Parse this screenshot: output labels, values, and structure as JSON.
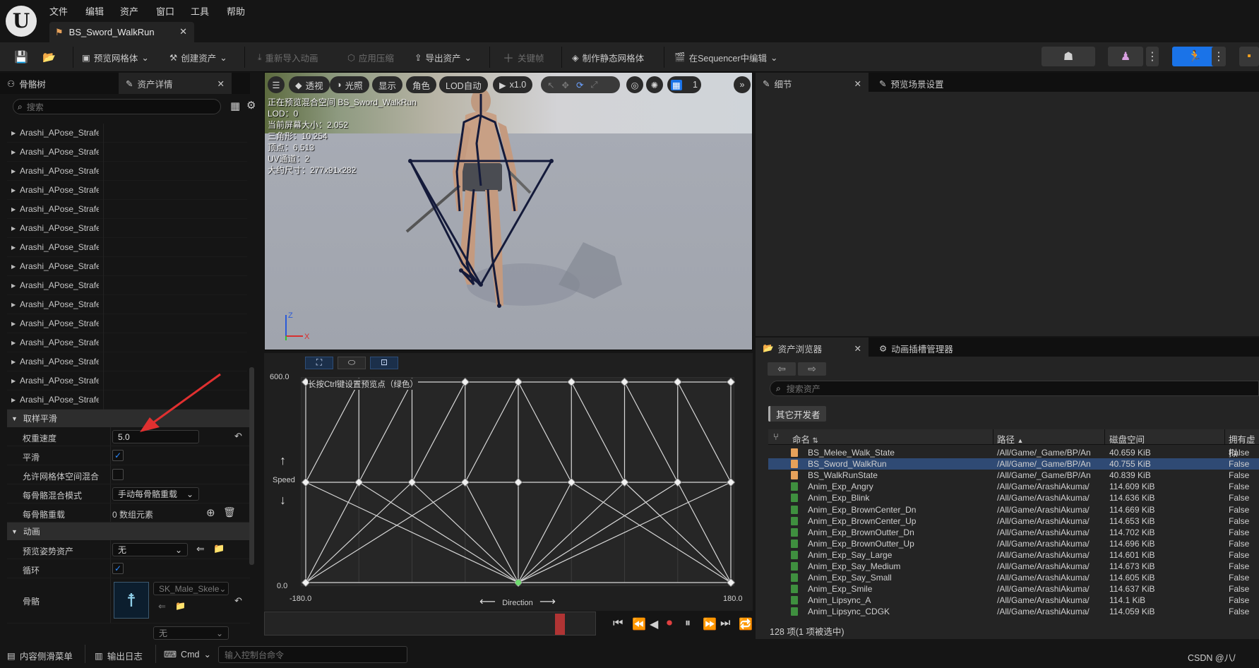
{
  "menu": {
    "items": [
      "文件",
      "编辑",
      "资产",
      "窗口",
      "工具",
      "帮助"
    ]
  },
  "document_tab": {
    "title": "BS_Sword_WalkRun"
  },
  "toolbar": {
    "preview_mesh": "预览网格体",
    "create_asset": "创建资产",
    "reimport": "重新导入动画",
    "apply_compression": "应用压缩",
    "export_asset": "导出资产",
    "key": "关键帧",
    "make_static_mesh": "制作静态网格体",
    "edit_in_sequencer": "在Sequencer中编辑"
  },
  "left_panel": {
    "tabs": [
      "骨骼树",
      "资产详情"
    ],
    "search_placeholder": "搜索",
    "tree_rows": [
      "Arashi_APose_Strafe_\\",
      "Arashi_APose_Strafe_\\",
      "Arashi_APose_Strafe_\\",
      "Arashi_APose_Strafe_\\",
      "Arashi_APose_Strafe_\\",
      "Arashi_APose_Strafe_\\",
      "Arashi_APose_Strafe_I",
      "Arashi_APose_Strafe_I",
      "Arashi_APose_Strafe_I",
      "Arashi_APose_Strafe_I",
      "Arashi_APose_Strafe_I",
      "Arashi_APose_Strafe_I",
      "Arashi_APose_Strafe_I",
      "Arashi_APose_Strafe_I",
      "Arashi_APose_Strafe_I"
    ],
    "section_sampling": "取样平滑",
    "weight_speed_label": "权重速度",
    "weight_speed_value": "5.0",
    "smooth_label": "平滑",
    "smooth_checked": true,
    "mesh_space_label": "允许网格体空间混合",
    "mesh_space_checked": false,
    "per_bone_mode_label": "每骨骼混合模式",
    "per_bone_mode_value": "手动每骨骼重载",
    "per_bone_override_label": "每骨骼重载",
    "per_bone_override_value": "0 数组元素",
    "section_animation": "动画",
    "preview_pose_label": "预览姿势资产",
    "preview_pose_value": "无",
    "loop_label": "循环",
    "loop_checked": true,
    "skeleton_label": "骨骼",
    "skeleton_value": "SK_Male_Skele",
    "next_combo_value": "无"
  },
  "viewport": {
    "buttons": {
      "perspective": "透视",
      "lit": "光照",
      "show": "显示",
      "character": "角色",
      "lod": "LOD自动",
      "speed": "x1.0",
      "grid_num": "1"
    },
    "info_lines": [
      "正在预览混合空间 BS_Sword_WalkRun",
      "LOD：0",
      "当前屏幕大小：2.052",
      "三角形：10,254",
      "顶点：6,513",
      "UV通道：2",
      "大约尺寸：277x91x282"
    ],
    "axis_z": "Z",
    "axis_x": "X"
  },
  "blend_space": {
    "hint": "长按Ctrl键设置预览点（绿色）",
    "y_max": "600.0",
    "y_min": "0.0",
    "x_min": "-180.0",
    "x_max": "180.0",
    "y_name": "Speed",
    "x_name": "Direction"
  },
  "chart_data": {
    "type": "scatter",
    "title": "",
    "xlabel": "Direction",
    "ylabel": "Speed",
    "xlim": [
      -180,
      180
    ],
    "ylim": [
      0,
      600
    ],
    "x_ticks": [
      "-180.0",
      "180.0"
    ],
    "y_ticks": [
      "0.0",
      "600.0"
    ],
    "grid": true,
    "series": [
      {
        "points": [
          [
            -180,
            0
          ],
          [
            0,
            0
          ],
          [
            180,
            0
          ],
          [
            -180,
            300
          ],
          [
            -135,
            300
          ],
          [
            -90,
            300
          ],
          [
            -45,
            300
          ],
          [
            0,
            300
          ],
          [
            45,
            300
          ],
          [
            90,
            300
          ],
          [
            135,
            300
          ],
          [
            180,
            300
          ],
          [
            -180,
            600
          ],
          [
            -135,
            600
          ],
          [
            -90,
            600
          ],
          [
            -45,
            600
          ],
          [
            0,
            600
          ],
          [
            45,
            600
          ],
          [
            90,
            600
          ],
          [
            135,
            600
          ],
          [
            180,
            600
          ]
        ]
      }
    ]
  },
  "details": {
    "tabs": [
      "细节",
      "预览场景设置"
    ]
  },
  "content_browser": {
    "tabs": [
      "资产浏览器",
      "动画插槽管理器"
    ],
    "search_placeholder": "搜索资产",
    "filter": "其它开发者",
    "columns": [
      "命名",
      "路径",
      "磁盘空间",
      "拥有虚拟"
    ],
    "rows": [
      {
        "name": "BS_Melee_Walk_State",
        "path": "/All/Game/_Game/BP/An",
        "size": "40.659 KiB",
        "flag": "False",
        "kind": "blend"
      },
      {
        "name": "BS_Sword_WalkRun",
        "path": "/All/Game/_Game/BP/An",
        "size": "40.755 KiB",
        "flag": "False",
        "kind": "blend",
        "selected": true
      },
      {
        "name": "BS_WalkRunState",
        "path": "/All/Game/_Game/BP/An",
        "size": "40.839 KiB",
        "flag": "False",
        "kind": "blend"
      },
      {
        "name": "Anim_Exp_Angry",
        "path": "/All/Game/ArashiAkuma/",
        "size": "114.609 KiB",
        "flag": "False",
        "kind": "anim"
      },
      {
        "name": "Anim_Exp_Blink",
        "path": "/All/Game/ArashiAkuma/",
        "size": "114.636 KiB",
        "flag": "False",
        "kind": "anim"
      },
      {
        "name": "Anim_Exp_BrownCenter_Dn",
        "path": "/All/Game/ArashiAkuma/",
        "size": "114.669 KiB",
        "flag": "False",
        "kind": "anim"
      },
      {
        "name": "Anim_Exp_BrownCenter_Up",
        "path": "/All/Game/ArashiAkuma/",
        "size": "114.653 KiB",
        "flag": "False",
        "kind": "anim"
      },
      {
        "name": "Anim_Exp_BrownOutter_Dn",
        "path": "/All/Game/ArashiAkuma/",
        "size": "114.702 KiB",
        "flag": "False",
        "kind": "anim"
      },
      {
        "name": "Anim_Exp_BrownOutter_Up",
        "path": "/All/Game/ArashiAkuma/",
        "size": "114.696 KiB",
        "flag": "False",
        "kind": "anim"
      },
      {
        "name": "Anim_Exp_Say_Large",
        "path": "/All/Game/ArashiAkuma/",
        "size": "114.601 KiB",
        "flag": "False",
        "kind": "anim"
      },
      {
        "name": "Anim_Exp_Say_Medium",
        "path": "/All/Game/ArashiAkuma/",
        "size": "114.673 KiB",
        "flag": "False",
        "kind": "anim"
      },
      {
        "name": "Anim_Exp_Say_Small",
        "path": "/All/Game/ArashiAkuma/",
        "size": "114.605 KiB",
        "flag": "False",
        "kind": "anim"
      },
      {
        "name": "Anim_Exp_Smile",
        "path": "/All/Game/ArashiAkuma/",
        "size": "114.637 KiB",
        "flag": "False",
        "kind": "anim"
      },
      {
        "name": "Anim_Lipsync_A",
        "path": "/All/Game/ArashiAkuma/",
        "size": "114.1 KiB",
        "flag": "False",
        "kind": "anim"
      },
      {
        "name": "Anim_Lipsync_CDGK",
        "path": "/All/Game/ArashiAkuma/",
        "size": "114.059 KiB",
        "flag": "False",
        "kind": "anim"
      }
    ],
    "item_count": "128 项(1 项被选中)"
  },
  "statusbar": {
    "content_drawer": "内容侧滑菜单",
    "output_log": "输出日志",
    "cmd": "Cmd",
    "console_placeholder": "输入控制台命令",
    "watermark": "CSDN @八/"
  },
  "colors": {
    "accent_blue": "#1a73e8",
    "selection": "#2f4a74",
    "blend_asset": "#e6a15a",
    "anim_asset": "#3f8f3f",
    "arrow_red": "#e03030"
  }
}
